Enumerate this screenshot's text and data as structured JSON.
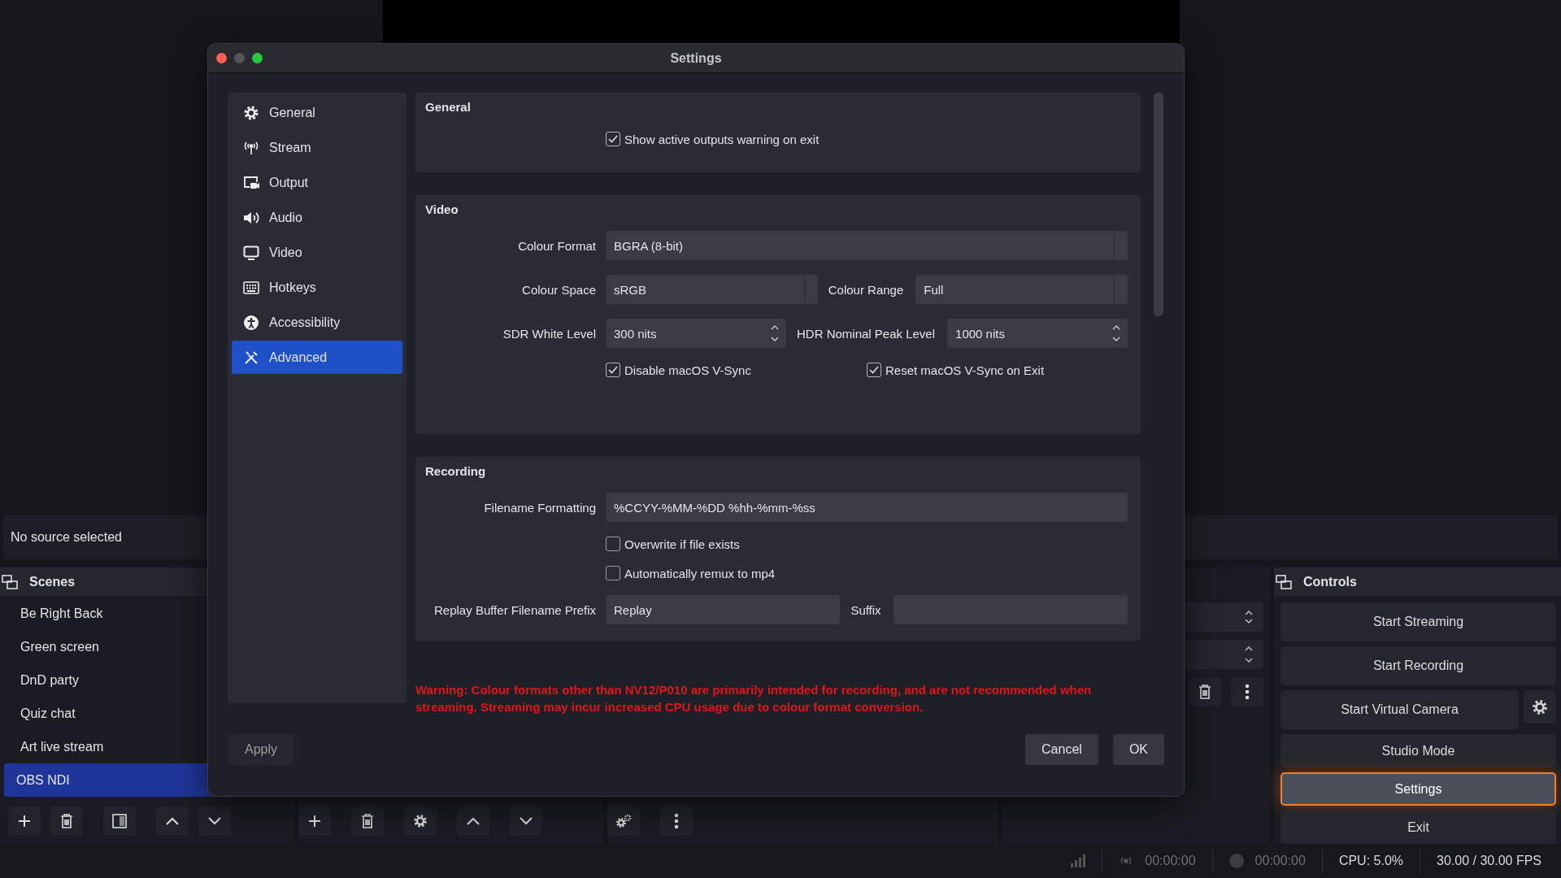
{
  "properties_bar": {
    "text": "No source selected"
  },
  "scenes": {
    "title": "Scenes",
    "items": [
      {
        "label": "Be Right Back",
        "selected": false
      },
      {
        "label": "Green screen",
        "selected": false
      },
      {
        "label": "DnD party",
        "selected": false
      },
      {
        "label": "Quiz chat",
        "selected": false
      },
      {
        "label": "Art live stream",
        "selected": false
      },
      {
        "label": "OBS NDI",
        "selected": true
      }
    ]
  },
  "controls": {
    "title": "Controls",
    "buttons": [
      {
        "label": "Start Streaming",
        "kind": "plain",
        "selected": false
      },
      {
        "label": "Start Recording",
        "kind": "plain",
        "selected": false
      },
      {
        "label": "Start Virtual Camera",
        "kind": "split",
        "selected": false
      },
      {
        "label": "Studio Mode",
        "kind": "plain",
        "selected": false
      },
      {
        "label": "Settings",
        "kind": "plain",
        "selected": true
      },
      {
        "label": "Exit",
        "kind": "plain",
        "selected": false
      }
    ]
  },
  "status_bar": {
    "stream_time": "00:00:00",
    "record_time": "00:00:00",
    "cpu": "CPU: 5.0%",
    "fps": "30.00 / 30.00 FPS"
  },
  "settings_dialog": {
    "title": "Settings",
    "sidebar": [
      {
        "label": "General",
        "selected": false
      },
      {
        "label": "Stream",
        "selected": false
      },
      {
        "label": "Output",
        "selected": false
      },
      {
        "label": "Audio",
        "selected": false
      },
      {
        "label": "Video",
        "selected": false
      },
      {
        "label": "Hotkeys",
        "selected": false
      },
      {
        "label": "Accessibility",
        "selected": false
      },
      {
        "label": "Advanced",
        "selected": true
      }
    ],
    "sections": [
      {
        "title": "General",
        "rows": [
          {
            "kind": "checkboxes",
            "items": [
              {
                "label": "Show active outputs warning on exit",
                "checked": true
              }
            ]
          }
        ]
      },
      {
        "title": "Video",
        "rows": [
          {
            "kind": "fields",
            "fields": [
              {
                "label": "Colour Format",
                "kind": "select",
                "value": "BGRA (8-bit)"
              }
            ]
          },
          {
            "kind": "fields",
            "fields": [
              {
                "label": "Colour Space",
                "kind": "select",
                "value": "sRGB"
              },
              {
                "label": "Colour Range",
                "kind": "select",
                "value": "Full"
              }
            ]
          },
          {
            "kind": "fields",
            "fields": [
              {
                "label": "SDR White Level",
                "kind": "spin",
                "value": "300 nits"
              },
              {
                "label": "HDR Nominal Peak Level",
                "kind": "spin",
                "value": "1000 nits"
              }
            ]
          },
          {
            "kind": "checkboxes",
            "items": [
              {
                "label": "Disable macOS V-Sync",
                "checked": true
              },
              {
                "label": "Reset macOS V-Sync on Exit",
                "checked": true
              }
            ]
          }
        ]
      },
      {
        "title": "Recording",
        "rows": [
          {
            "kind": "fields",
            "fields": [
              {
                "label": "Filename Formatting",
                "kind": "text",
                "value": "%CCYY-%MM-%DD %hh-%mm-%ss"
              }
            ]
          },
          {
            "kind": "checkboxes",
            "items": [
              {
                "label": "Overwrite if file exists",
                "checked": false
              }
            ]
          },
          {
            "kind": "checkboxes",
            "items": [
              {
                "label": "Automatically remux to mp4",
                "checked": false
              }
            ]
          },
          {
            "kind": "fields",
            "fields": [
              {
                "label": "Replay Buffer Filename Prefix",
                "kind": "text",
                "value": "Replay"
              },
              {
                "label": "Suffix",
                "kind": "text"
              }
            ]
          }
        ]
      }
    ],
    "warning": "Warning: Colour formats other than NV12/P010 are primarily intended for recording, and are not recommended when streaming. Streaming may incur increased CPU usage due to colour format conversion.",
    "buttons": {
      "apply": "Apply",
      "cancel": "Cancel",
      "ok": "OK"
    }
  }
}
